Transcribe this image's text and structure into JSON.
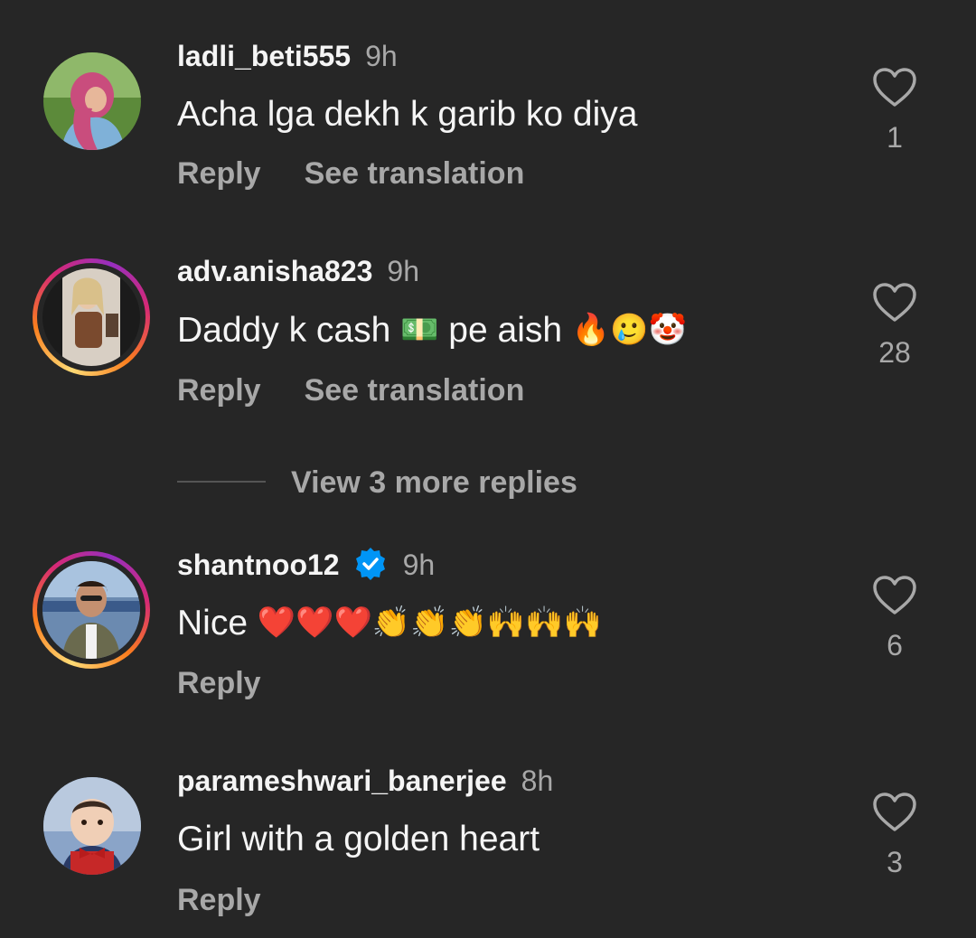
{
  "colors": {
    "background": "#262626",
    "primary_text": "#f5f5f5",
    "secondary_text": "#a8a8a8",
    "verified_blue": "#0095f6"
  },
  "comments": [
    {
      "username": "ladli_beti555",
      "time": "9h",
      "text": "Acha lga dekh k garib ko diya",
      "reply_label": "Reply",
      "translation_label": "See translation",
      "likes": "1",
      "has_story_ring": false,
      "verified": false
    },
    {
      "username": "adv.anisha823",
      "time": "9h",
      "text_before": "Daddy k cash ",
      "emoji_money": "💵",
      "text_after": " pe aish ",
      "emoji_trail": "🔥🥲🤡",
      "reply_label": "Reply",
      "translation_label": "See translation",
      "likes": "28",
      "has_story_ring": true,
      "verified": false
    },
    {
      "username": "shantnoo12",
      "time": "9h",
      "text": "Nice ",
      "emoji_trail": "❤️❤️❤️👏👏👏🙌🙌🙌",
      "reply_label": "Reply",
      "likes": "6",
      "has_story_ring": true,
      "verified": true,
      "verified_icon": "verified-badge-icon"
    },
    {
      "username": "parameshwari_banerjee",
      "time": "8h",
      "text": "Girl with a golden heart",
      "reply_label": "Reply",
      "likes": "3",
      "has_story_ring": false,
      "verified": false
    }
  ],
  "view_replies": {
    "label": "View 3 more replies"
  },
  "icons": {
    "like": "heart-outline-icon"
  }
}
